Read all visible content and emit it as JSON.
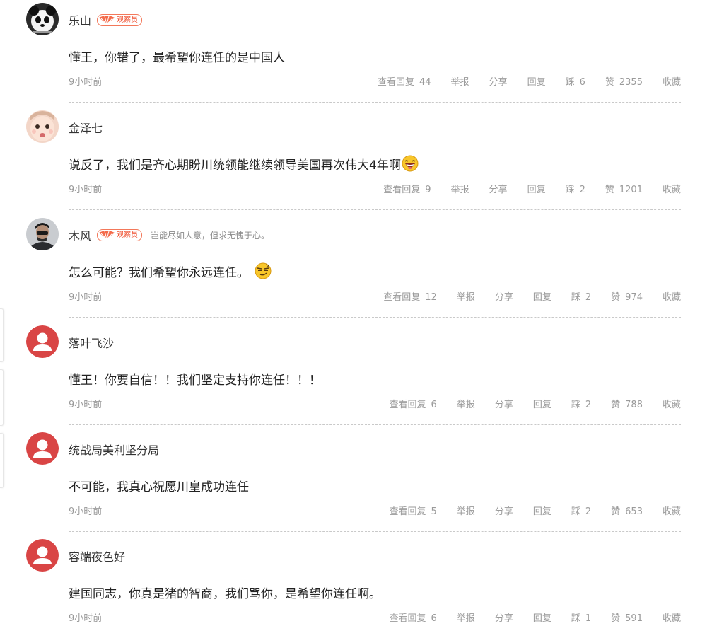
{
  "comments": [
    {
      "username": "乐山",
      "badge": "观察员",
      "signature": "",
      "content": "懂王，你错了，最希望你连任的是中国人",
      "emoji": "",
      "time": "9小时前",
      "view_replies_label": "查看回复",
      "reply_count": "44",
      "report_label": "举报",
      "share_label": "分享",
      "reply_label": "回复",
      "dislike_label": "踩",
      "dislike_count": "6",
      "like_label": "赞",
      "like_count": "2355",
      "favorite_label": "收藏",
      "avatar": "panda-avatar"
    },
    {
      "username": "金泽七",
      "badge": "",
      "signature": "",
      "content": "说反了，我们是齐心期盼川统领能继续领导美国再次伟大4年啊",
      "emoji": "laughing-emoji",
      "time": "9小时前",
      "view_replies_label": "查看回复",
      "reply_count": "9",
      "report_label": "举报",
      "share_label": "分享",
      "reply_label": "回复",
      "dislike_label": "踩",
      "dislike_count": "2",
      "like_label": "赞",
      "like_count": "1201",
      "favorite_label": "收藏",
      "avatar": "baby-photo-avatar"
    },
    {
      "username": "木风",
      "badge": "观察员",
      "signature": "岂能尽如人意，但求无愧于心。",
      "content": "怎么可能？我们希望你永远连任。",
      "emoji": "smug-emoji",
      "time": "9小时前",
      "view_replies_label": "查看回复",
      "reply_count": "12",
      "report_label": "举报",
      "share_label": "分享",
      "reply_label": "回复",
      "dislike_label": "踩",
      "dislike_count": "2",
      "like_label": "赞",
      "like_count": "974",
      "favorite_label": "收藏",
      "avatar": "person-photo-avatar"
    },
    {
      "username": "落叶飞沙",
      "badge": "",
      "signature": "",
      "content": "懂王！你要自信！！我们坚定支持你连任！！！",
      "emoji": "",
      "time": "9小时前",
      "view_replies_label": "查看回复",
      "reply_count": "6",
      "report_label": "举报",
      "share_label": "分享",
      "reply_label": "回复",
      "dislike_label": "踩",
      "dislike_count": "2",
      "like_label": "赞",
      "like_count": "788",
      "favorite_label": "收藏",
      "avatar": "default-user-avatar"
    },
    {
      "username": "统战局美利坚分局",
      "badge": "",
      "signature": "",
      "content": "不可能，我真心祝愿川皇成功连任",
      "emoji": "",
      "time": "9小时前",
      "view_replies_label": "查看回复",
      "reply_count": "5",
      "report_label": "举报",
      "share_label": "分享",
      "reply_label": "回复",
      "dislike_label": "踩",
      "dislike_count": "2",
      "like_label": "赞",
      "like_count": "653",
      "favorite_label": "收藏",
      "avatar": "default-user-avatar"
    },
    {
      "username": "容端夜色好",
      "badge": "",
      "signature": "",
      "content": "建国同志，你真是猪的智商，我们骂你，是希望你连任啊。",
      "emoji": "",
      "time": "9小时前",
      "view_replies_label": "查看回复",
      "reply_count": "6",
      "report_label": "举报",
      "share_label": "分享",
      "reply_label": "回复",
      "dislike_label": "踩",
      "dislike_count": "1",
      "like_label": "赞",
      "like_count": "591",
      "favorite_label": "收藏",
      "avatar": "default-user-avatar"
    }
  ],
  "colors": {
    "badge": "#ef4a29",
    "default_avatar": "#d94545",
    "meta_text": "#9a9a9a",
    "divider": "#c9c9c9"
  }
}
